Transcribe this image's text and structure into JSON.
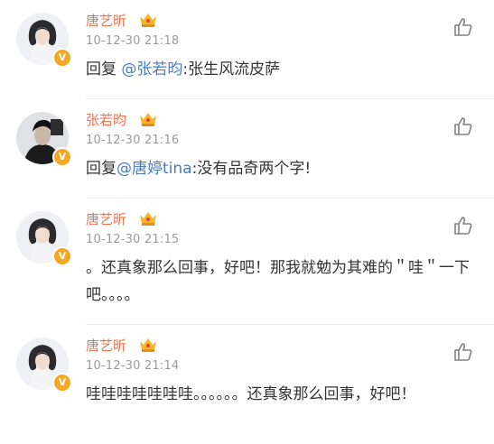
{
  "comments": [
    {
      "name": "唐艺昕",
      "time": "10-12-30 21:18",
      "reply_prefix": "回复 ",
      "mention": "@张若昀",
      "text": ":张生风流皮萨",
      "avatar": "female-avatar",
      "verified_badge": "V"
    },
    {
      "name": "张若昀",
      "time": "10-12-30 21:16",
      "reply_prefix": "回复",
      "mention": "@唐婷tina",
      "text": ":没有品奇两个字!",
      "avatar": "male-avatar",
      "verified_badge": "V"
    },
    {
      "name": "唐艺昕",
      "time": "10-12-30 21:15",
      "text": "。还真象那么回事，好吧！那我就勉为其难的＂哇＂一下吧。。。。",
      "avatar": "female-avatar",
      "verified_badge": "V"
    },
    {
      "name": "唐艺昕",
      "time": "10-12-30 21:14",
      "text": "哇哇哇哇哇哇哇。。。。。。还真象那么回事，好吧！",
      "avatar": "female-avatar",
      "verified_badge": "V"
    }
  ],
  "icons": {
    "like": "thumbs-up-icon",
    "vip": "vip-crown-icon",
    "verified": "verified-v-icon"
  },
  "colors": {
    "name": "#eb7350",
    "mention": "#4a7db8",
    "timestamp": "#9a9a9a",
    "text": "#333333",
    "badge": "#f5a623"
  }
}
